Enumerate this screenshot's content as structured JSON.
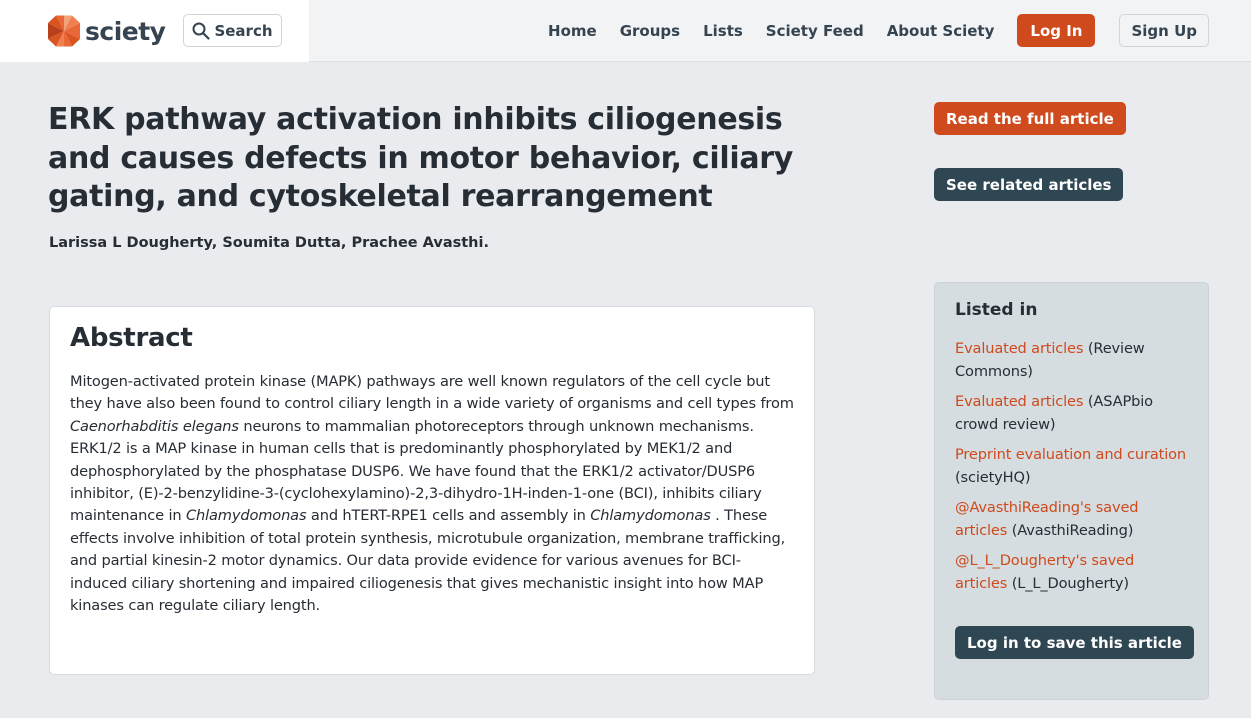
{
  "header": {
    "logo_text": "sciety",
    "search_label": "Search",
    "nav": [
      {
        "label": "Home"
      },
      {
        "label": "Groups"
      },
      {
        "label": "Lists"
      },
      {
        "label": "Sciety Feed"
      },
      {
        "label": "About Sciety"
      }
    ],
    "login_label": "Log In",
    "signup_label": "Sign Up"
  },
  "article": {
    "title": "ERK pathway activation inhibits ciliogenesis and causes defects in motor behavior, ciliary gating, and cytoskeletal rearrangement",
    "authors": "Larissa L Dougherty, Soumita Dutta, Prachee Avasthi."
  },
  "abstract": {
    "heading": "Abstract",
    "segments": [
      {
        "text": "Mitogen-activated protein kinase (MAPK) pathways are well known regulators of the cell cycle but they have also been found to control ciliary length in a wide variety of organisms and cell types from ",
        "italic": false
      },
      {
        "text": "Caenorhabditis elegans",
        "italic": true
      },
      {
        "text": " neurons to mammalian photoreceptors through unknown mechanisms. ERK1/2 is a MAP kinase in human cells that is predominantly phosphorylated by MEK1/2 and dephosphorylated by the phosphatase DUSP6. We have found that the ERK1/2 activator/DUSP6 inhibitor, (E)-2-benzylidine-3-(cyclohexylamino)-2,3-dihydro-1H-inden-1-one (BCI), inhibits ciliary maintenance in ",
        "italic": false
      },
      {
        "text": "Chlamydomonas",
        "italic": true
      },
      {
        "text": " and hTERT-RPE1 cells and assembly in ",
        "italic": false
      },
      {
        "text": "Chlamydomonas",
        "italic": true
      },
      {
        "text": " . These effects involve inhibition of total protein synthesis, microtubule organization, membrane trafficking, and partial kinesin-2 motor dynamics. Our data provide evidence for various avenues for BCI-induced ciliary shortening and impaired ciliogenesis that gives mechanistic insight into how MAP kinases can regulate ciliary length.",
        "italic": false
      }
    ]
  },
  "actions": {
    "read_full_label": "Read the full article",
    "see_related_label": "See related articles"
  },
  "listed_in": {
    "heading": "Listed in",
    "items": [
      {
        "link": "Evaluated articles",
        "owner": "(Review Commons)"
      },
      {
        "link": "Evaluated articles",
        "owner": "(ASAPbio crowd review)"
      },
      {
        "link": "Preprint evaluation and curation",
        "owner": "(scietyHQ)"
      },
      {
        "link": "@AvasthiReading's saved articles",
        "owner": "(AvasthiReading)"
      },
      {
        "link": "@L_L_Dougherty's saved articles",
        "owner": "(L_L_Dougherty)"
      }
    ],
    "save_label": "Log in to save this article"
  },
  "colors": {
    "brand_orange": "#cf4a1c",
    "dark_slate": "#2f4753",
    "page_bg": "#e9ebef",
    "sidebar_bg": "#d6dde1"
  }
}
